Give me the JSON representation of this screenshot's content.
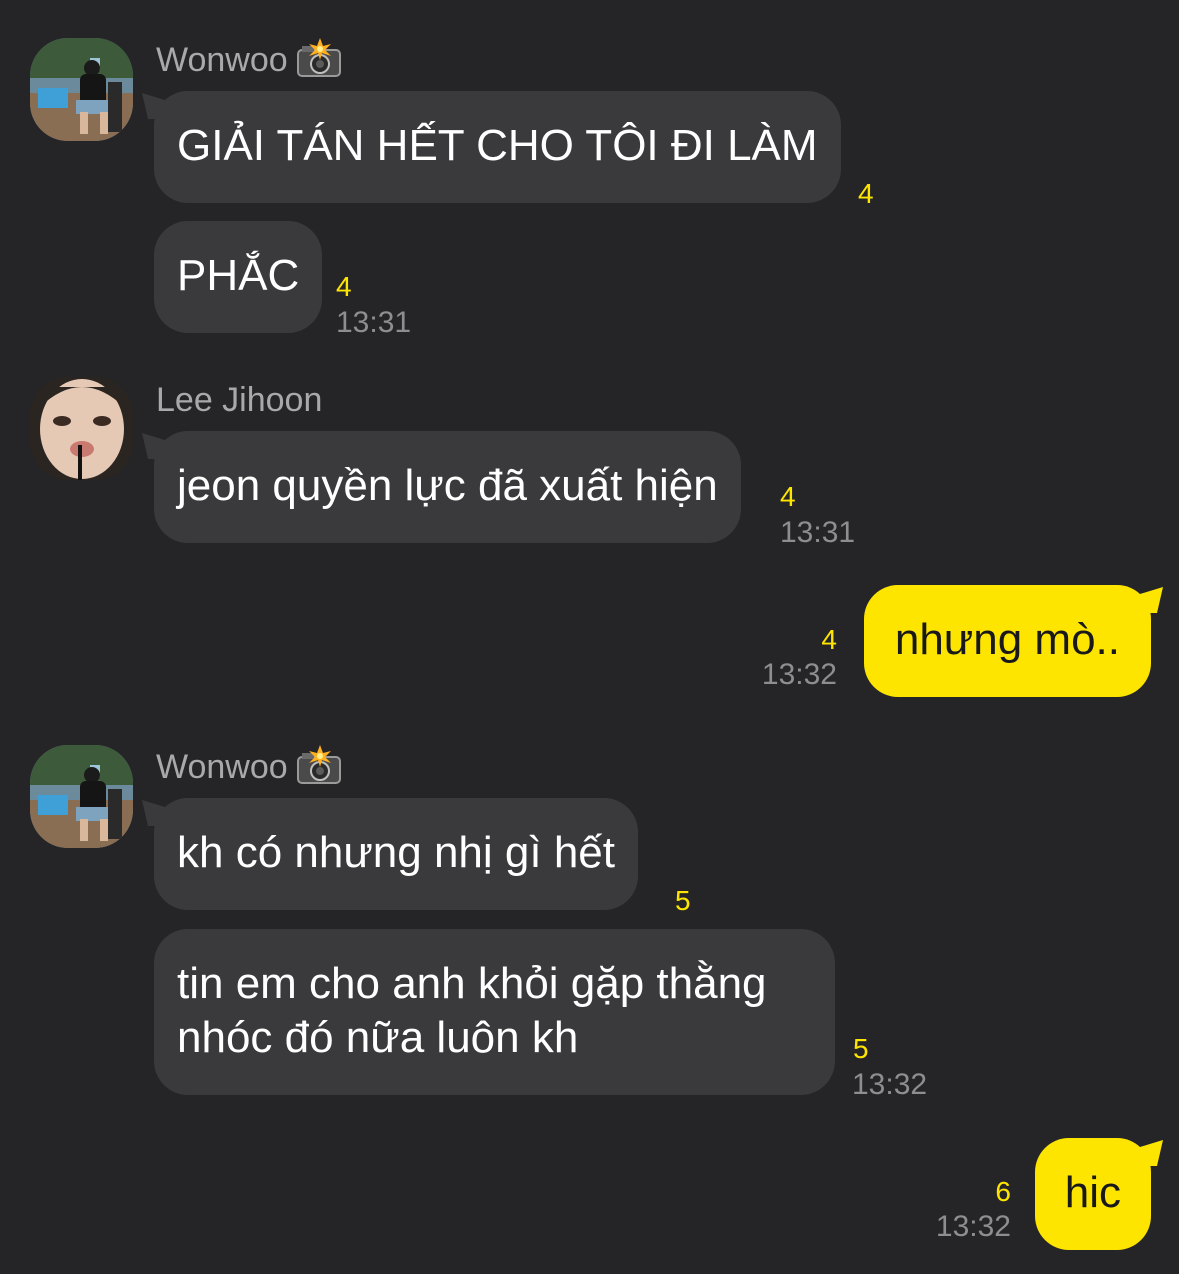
{
  "groups": {
    "wonwoo1": {
      "sender": "Wonwoo",
      "messages": [
        {
          "text": "GIẢI TÁN HẾT CHO TÔI ĐI LÀM",
          "unread": "4"
        },
        {
          "text": "PHẮC",
          "unread": "4",
          "time": "13:31"
        }
      ]
    },
    "jihoon": {
      "sender": "Lee Jihoon",
      "messages": [
        {
          "text": "jeon quyền lực đã xuất hiện",
          "unread": "4",
          "time": "13:31"
        }
      ]
    },
    "mine1": {
      "messages": [
        {
          "text": "nhưng mò..",
          "unread": "4",
          "time": "13:32"
        }
      ]
    },
    "wonwoo2": {
      "sender": "Wonwoo",
      "messages": [
        {
          "text": "kh có nhưng nhị gì hết",
          "unread": "5"
        },
        {
          "text_line1": "tin em cho anh khỏi gặp thằng",
          "text_line2": "nhóc đó nữa luôn kh",
          "unread": "5",
          "time": "13:32"
        }
      ]
    },
    "mine2": {
      "messages": [
        {
          "text": "hic",
          "unread": "6",
          "time": "13:32"
        }
      ]
    }
  },
  "colors": {
    "background": "#252527",
    "incoming_bubble": "#3a3a3d",
    "outgoing_bubble": "#fee500",
    "unread_count": "#fee500",
    "timestamp": "#8e8e92",
    "sender_name": "#a9a9ac"
  },
  "icons": {
    "sender_badge": "camera-flash-icon",
    "avatar_wonwoo": "avatar-photo-outdoor-seated",
    "avatar_jihoon": "avatar-photo-face"
  }
}
